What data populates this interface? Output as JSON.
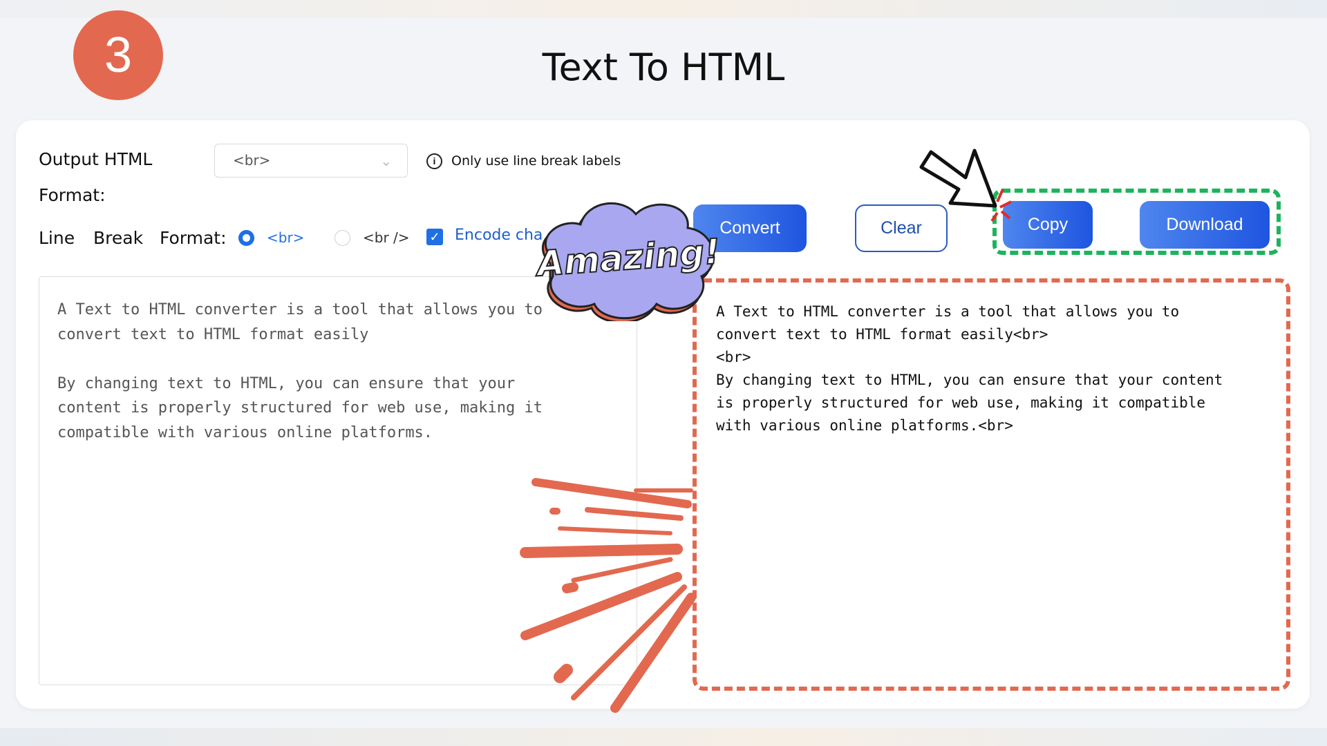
{
  "step_badge": "3",
  "page_title": "Text To HTML",
  "options": {
    "output_label_line1": "Output HTML",
    "output_label_line2": "Format:",
    "output_select_value": "<br>",
    "info_text": "Only use line break labels",
    "line_break_label": [
      "Line",
      "Break",
      "Format:"
    ],
    "radio_br": "<br>",
    "radio_br_slash": "<br />",
    "encode_label": "Encode cha"
  },
  "buttons": {
    "convert": "Convert",
    "clear": "Clear",
    "copy": "Copy",
    "download": "Download"
  },
  "input_text": "A Text to HTML converter is a tool that allows you to\nconvert text to HTML format easily\n\nBy changing text to HTML, you can ensure that your\ncontent is properly structured for web use, making it\ncompatible with various online platforms.",
  "output_text": "A Text to HTML converter is a tool that allows you to\nconvert text to HTML format easily<br>\n<br>\nBy changing text to HTML, you can ensure that your content\nis properly structured for web use, making it compatible\nwith various online platforms.<br>",
  "sticker_text": "Amazing!",
  "colors": {
    "accent": "#1f6fe5",
    "badge": "#e2694f",
    "highlight": "#1cb45c"
  }
}
